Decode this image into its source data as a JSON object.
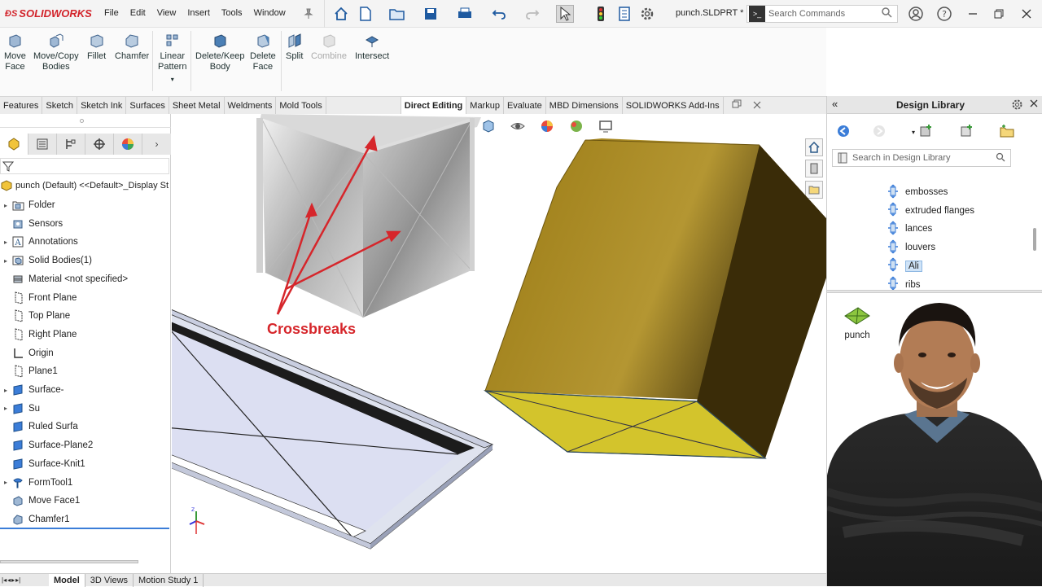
{
  "app": {
    "name": "SOLIDWORKS",
    "filename": "punch.SLDPRT *"
  },
  "menu": [
    "File",
    "Edit",
    "View",
    "Insert",
    "Tools",
    "Window"
  ],
  "search": {
    "placeholder": "Search Commands"
  },
  "commands": [
    {
      "label": "Move\nFace",
      "enabled": true
    },
    {
      "label": "Move/Copy\nBodies",
      "enabled": true
    },
    {
      "label": "Fillet",
      "enabled": true
    },
    {
      "label": "Chamfer",
      "enabled": true
    },
    {
      "label": "Linear\nPattern",
      "enabled": true
    },
    {
      "label": "Delete/Keep\nBody",
      "enabled": true
    },
    {
      "label": "Delete\nFace",
      "enabled": true
    },
    {
      "label": "Split",
      "enabled": true
    },
    {
      "label": "Combine",
      "enabled": false
    },
    {
      "label": "Intersect",
      "enabled": true
    }
  ],
  "tabs": [
    "Features",
    "Sketch",
    "Sketch Ink",
    "Surfaces",
    "Sheet Metal",
    "Weldments",
    "Mold Tools",
    "Direct Editing",
    "Markup",
    "Evaluate",
    "MBD Dimensions",
    "SOLIDWORKS Add-Ins"
  ],
  "active_tab": "Direct Editing",
  "feature_tree": {
    "root": "punch (Default) <<Default>_Display St",
    "items": [
      {
        "label": "Folder",
        "expandable": true,
        "icon": "folder-icon"
      },
      {
        "label": "Sensors",
        "expandable": false,
        "icon": "sensor-icon"
      },
      {
        "label": "Annotations",
        "expandable": true,
        "icon": "annotation-icon"
      },
      {
        "label": "Solid Bodies(1)",
        "expandable": true,
        "icon": "solid-bodies-icon"
      },
      {
        "label": "Material <not specified>",
        "expandable": false,
        "icon": "material-icon"
      },
      {
        "label": "Front Plane",
        "expandable": false,
        "icon": "plane-icon"
      },
      {
        "label": "Top Plane",
        "expandable": false,
        "icon": "plane-icon"
      },
      {
        "label": "Right Plane",
        "expandable": false,
        "icon": "plane-icon"
      },
      {
        "label": "Origin",
        "expandable": false,
        "icon": "origin-icon"
      },
      {
        "label": "Plane1",
        "expandable": false,
        "icon": "plane-icon"
      },
      {
        "label": "Surface-",
        "expandable": true,
        "icon": "surface-icon"
      },
      {
        "label": "Su",
        "expandable": true,
        "icon": "surface-icon"
      },
      {
        "label": "Ruled Surfa",
        "expandable": false,
        "icon": "surface-icon"
      },
      {
        "label": "Surface-Plane2",
        "expandable": false,
        "icon": "surface-icon"
      },
      {
        "label": "Surface-Knit1",
        "expandable": false,
        "icon": "surface-icon"
      },
      {
        "label": "FormTool1",
        "expandable": true,
        "icon": "formtool-icon"
      },
      {
        "label": "Move Face1",
        "expandable": false,
        "icon": "moveface-icon"
      },
      {
        "label": "Chamfer1",
        "expandable": false,
        "icon": "chamfer-icon"
      }
    ]
  },
  "bottom_tabs": [
    "Model",
    "3D Views",
    "Motion Study 1"
  ],
  "design_library": {
    "title": "Design Library",
    "search_placeholder": "Search in Design Library",
    "items": [
      "embosses",
      "extruded flanges",
      "lances",
      "louvers",
      "Ali",
      "ribs"
    ],
    "selected": "Ali",
    "preview_label": "punch"
  },
  "viewport": {
    "annotation": "Crossbreaks"
  },
  "colors": {
    "brand": "#d2232a",
    "annotation": "#d6262b",
    "body_top": "#9c7b14",
    "body_side": "#3b2c08",
    "body_bottom": "#d6c52b"
  }
}
